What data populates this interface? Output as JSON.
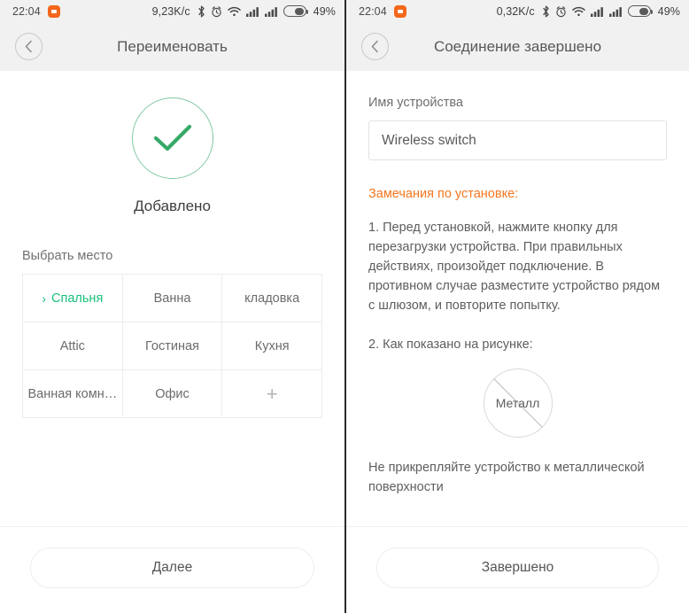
{
  "left": {
    "statusbar": {
      "time": "22:04",
      "app_icon": "app-notification-icon",
      "network_speed": "9,23K/c",
      "icons": [
        "bluetooth-icon",
        "alarm-clock-icon",
        "wifi-icon",
        "signal-icon",
        "signal-icon"
      ],
      "battery_percent": "49%",
      "battery_level": 49
    },
    "titlebar": {
      "back_icon": "back-chevron-icon",
      "title": "Переименовать"
    },
    "status": {
      "check_icon": "check-circle-icon",
      "label": "Добавлено"
    },
    "rooms_section": {
      "label": "Выбрать место",
      "selected_index": 0,
      "cells": [
        {
          "label": "Спальня",
          "selected": true,
          "type": "room"
        },
        {
          "label": "Ванна",
          "selected": false,
          "type": "room"
        },
        {
          "label": "кладовка",
          "selected": false,
          "type": "room"
        },
        {
          "label": "Attic",
          "selected": false,
          "type": "room"
        },
        {
          "label": "Гостиная",
          "selected": false,
          "type": "room"
        },
        {
          "label": "Кухня",
          "selected": false,
          "type": "room"
        },
        {
          "label": "Ванная комн…",
          "selected": false,
          "type": "room"
        },
        {
          "label": "Офис",
          "selected": false,
          "type": "room"
        },
        {
          "label": "+",
          "selected": false,
          "type": "add"
        }
      ]
    },
    "footer": {
      "button_label": "Далее"
    }
  },
  "right": {
    "statusbar": {
      "time": "22:04",
      "app_icon": "app-notification-icon",
      "network_speed": "0,32K/c",
      "icons": [
        "bluetooth-icon",
        "alarm-clock-icon",
        "wifi-icon",
        "signal-icon",
        "signal-icon"
      ],
      "battery_percent": "49%",
      "battery_level": 49
    },
    "titlebar": {
      "back_icon": "back-chevron-icon",
      "title": "Соединение завершено"
    },
    "device_name": {
      "label": "Имя устройства",
      "value": "Wireless switch",
      "placeholder": "Wireless switch"
    },
    "notes": {
      "heading": "Замечания по установке:",
      "item1": "1. Перед установкой, нажмите кнопку для перезагрузки устройства. При правильных действиях, произойдет подключение. В противном случае разместите устройство рядом с шлюзом, и повторите попытку.",
      "item2": "2. Как показано на рисунке:",
      "diagram_label": "Металл",
      "diagram_icon": "no-metal-icon",
      "bottom_note": "Не прикрепляйте устройство к металлической поверхности"
    },
    "footer": {
      "button_label": "Завершено"
    }
  },
  "colors": {
    "accent_green": "#18c07a",
    "check_circle_border": "#80c9a3",
    "check_mark": "#35a968",
    "notes_orange": "#f4761e",
    "app_icon_orange": "#f4671c",
    "statusbar_bg": "#f1f1f1"
  }
}
